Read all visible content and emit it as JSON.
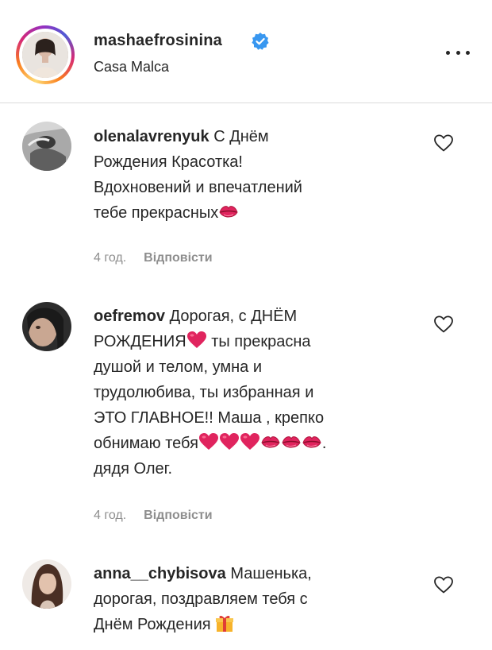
{
  "post": {
    "username": "mashaefrosinina",
    "location": "Casa Malca"
  },
  "comments": [
    {
      "username": "olenalavrenyuk",
      "lines": [
        "С Днём",
        "Рождения Красотка!",
        "Вдохновений и впечатлений",
        "тебе прекрасных"
      ],
      "time": "4 год.",
      "reply_label": "Відповісти"
    },
    {
      "username": "oefremov",
      "lines": [
        "Дорогая, с ДНЁМ",
        "РОЖДЕНИЯ",
        "ты прекрасна",
        "душой и телом, умна и",
        "трудолюбива, ты избранная и",
        "ЭТО ГЛАВНОЕ!! Маша , крепко",
        "обнимаю тебя",
        ".",
        "дядя Олег."
      ],
      "time": "4 год.",
      "reply_label": "Відповісти"
    },
    {
      "username": "anna__chybisova",
      "lines": [
        "Машенька,",
        "дорогая, поздравляем тебя с",
        "Днём Рождения"
      ]
    }
  ],
  "icons": {
    "verified": "verified-badge-icon",
    "more": "more-options-icon",
    "like": "heart-outline-icon",
    "kiss": "kiss-mark-emoji",
    "heart": "red-heart-emoji",
    "gift": "gift-emoji"
  },
  "colors": {
    "verified": "#3897f0",
    "meta": "#8e8e8e",
    "divider": "#dbdbdb"
  }
}
